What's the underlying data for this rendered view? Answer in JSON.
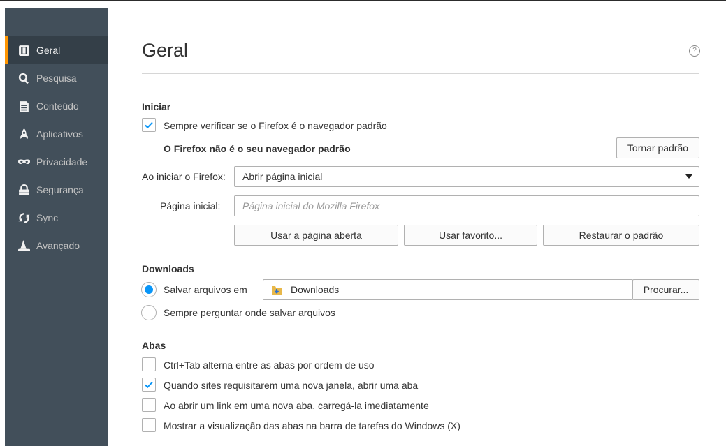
{
  "sidebar": {
    "items": [
      {
        "label": "Geral",
        "icon": "general-icon"
      },
      {
        "label": "Pesquisa",
        "icon": "search-icon"
      },
      {
        "label": "Conteúdo",
        "icon": "document-icon"
      },
      {
        "label": "Aplicativos",
        "icon": "rocket-icon"
      },
      {
        "label": "Privacidade",
        "icon": "mask-icon"
      },
      {
        "label": "Segurança",
        "icon": "lock-icon"
      },
      {
        "label": "Sync",
        "icon": "sync-icon"
      },
      {
        "label": "Avançado",
        "icon": "wizard-hat-icon"
      }
    ],
    "active_index": 0,
    "accent_color": "#ff9500"
  },
  "page": {
    "title": "Geral",
    "help": "?"
  },
  "startup": {
    "heading": "Iniciar",
    "check_default_label": "Sempre verificar se o Firefox é o navegador padrão",
    "check_default_checked": true,
    "not_default_text": "O Firefox não é o seu navegador padrão",
    "make_default_button": "Tornar padrão",
    "on_start_label": "Ao iniciar o Firefox:",
    "on_start_value": "Abrir página inicial",
    "homepage_label": "Página inicial:",
    "homepage_placeholder": "Página inicial do Mozilla Firefox",
    "use_current_button": "Usar a página aberta",
    "use_bookmark_button": "Usar favorito...",
    "restore_default_button": "Restaurar o padrão"
  },
  "downloads": {
    "heading": "Downloads",
    "save_to_label": "Salvar arquivos em",
    "folder_name": "Downloads",
    "browse_button": "Procurar...",
    "always_ask_label": "Sempre perguntar onde salvar arquivos",
    "selected": "save_to"
  },
  "tabs": {
    "heading": "Abas",
    "options": [
      {
        "label": "Ctrl+Tab alterna entre as abas por ordem de uso",
        "checked": false
      },
      {
        "label": "Quando sites requisitarem uma nova janela, abrir uma aba",
        "checked": true
      },
      {
        "label": "Ao abrir um link em uma nova aba, carregá-la imediatamente",
        "checked": false
      },
      {
        "label": "Mostrar a visualização das abas na barra de tarefas do Windows (X)",
        "checked": false
      }
    ]
  }
}
